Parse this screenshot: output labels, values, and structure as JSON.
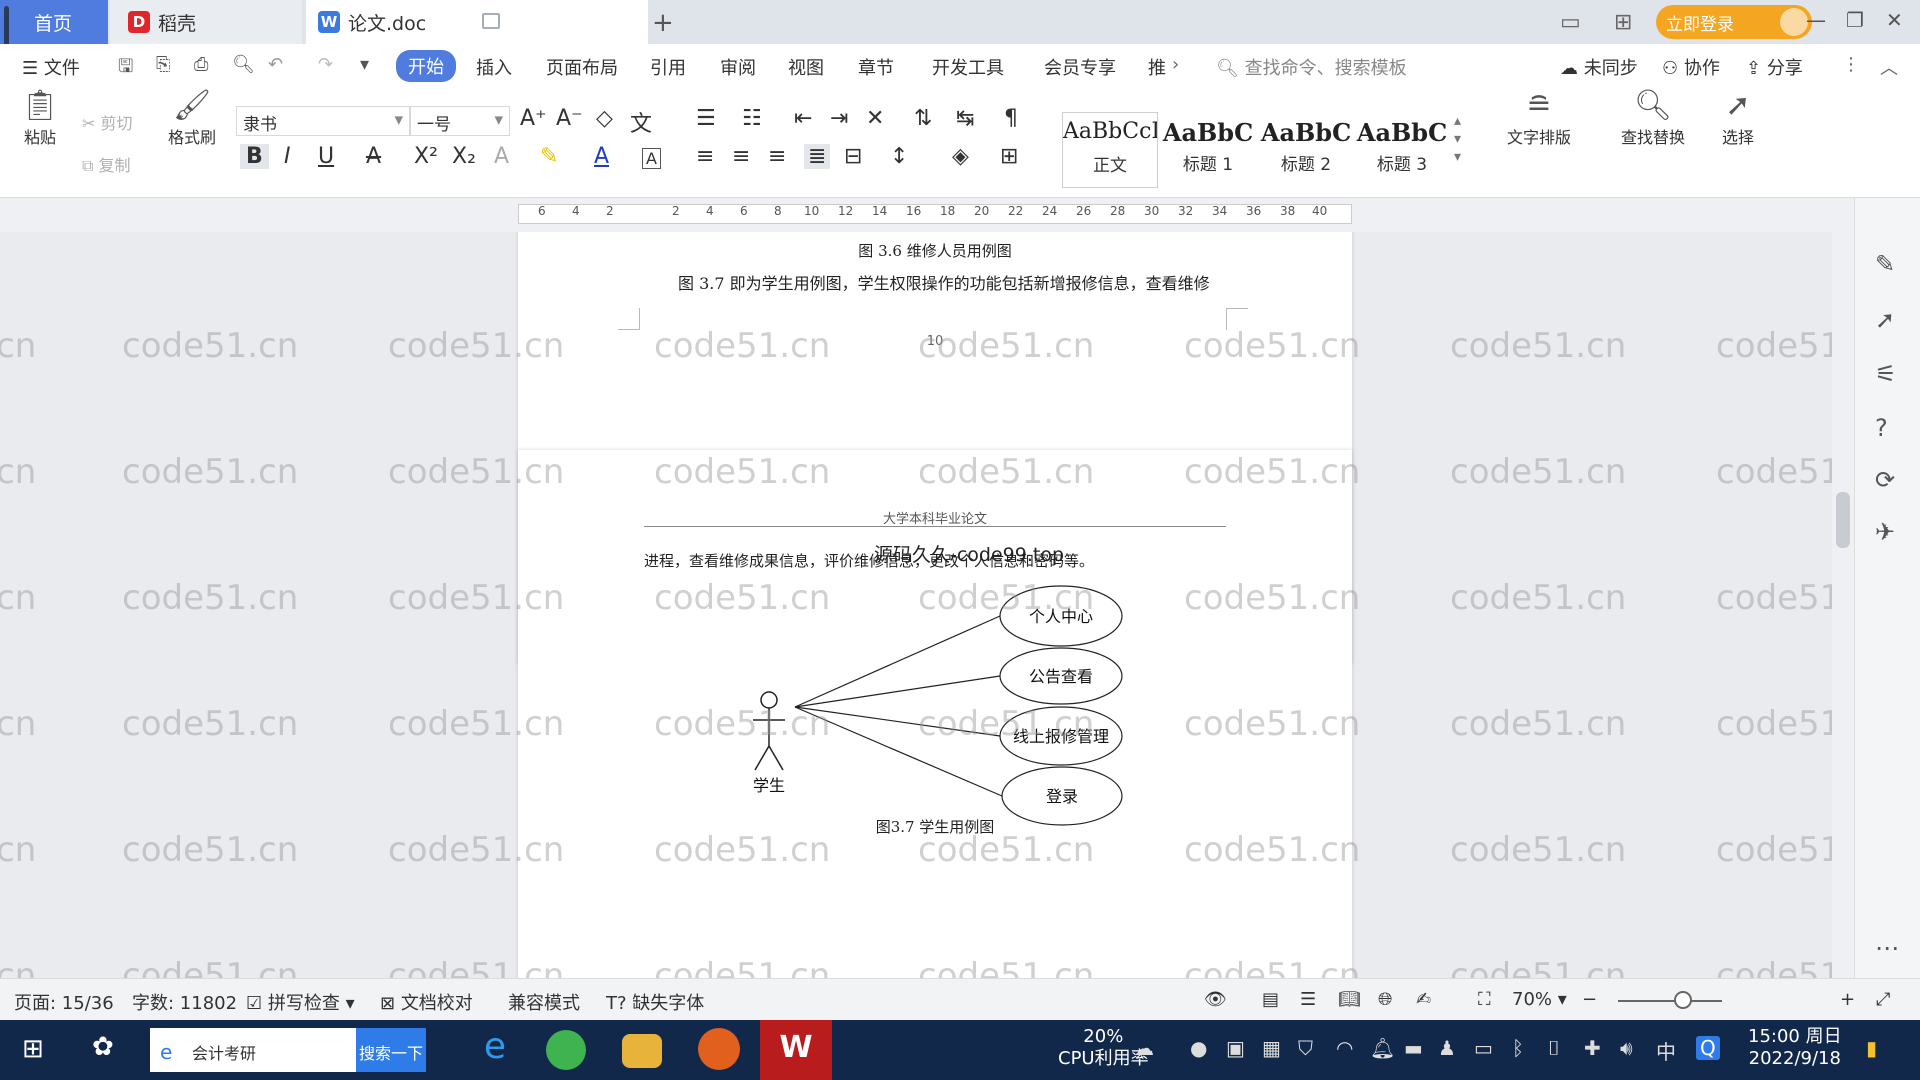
{
  "tabs": [
    {
      "label": "首页"
    },
    {
      "label": "稻壳"
    },
    {
      "label": "论文.doc"
    }
  ],
  "login_label": "立即登录",
  "menu": {
    "file": "文件",
    "items": [
      "开始",
      "插入",
      "页面布局",
      "引用",
      "审阅",
      "视图",
      "章节",
      "开发工具",
      "会员专享",
      "推"
    ],
    "search_cmd": "查找命令、搜索模板",
    "unsynced": "未同步",
    "collab": "协作",
    "share": "分享"
  },
  "toolbar": {
    "paste": "粘贴",
    "cut": "剪切",
    "copy": "复制",
    "format_painter": "格式刷",
    "font_name": "隶书",
    "font_size": "一号",
    "styles": [
      {
        "sample": "AaBbCcI",
        "name": "正文"
      },
      {
        "sample": "AaBbC",
        "name": "标题 1"
      },
      {
        "sample": "AaBbC",
        "name": "标题 2"
      },
      {
        "sample": "AaBbC",
        "name": "标题 3"
      }
    ],
    "text_layout": "文字排版",
    "find_replace": "查找替换",
    "select": "选择"
  },
  "ruler_ticks": [
    "6",
    "4",
    "2",
    "2",
    "4",
    "6",
    "8",
    "10",
    "12",
    "14",
    "16",
    "18",
    "20",
    "22",
    "24",
    "26",
    "28",
    "30",
    "32",
    "34",
    "36",
    "38",
    "40"
  ],
  "watermark": "code51.cn",
  "document": {
    "page1": {
      "figure_caption": "图 3.6  维修人员用例图",
      "paragraph": "图 3.7 即为学生用例图，学生权限操作的功能包括新增报修信息，查看维修",
      "page_number": "10"
    },
    "page2": {
      "header": "大学本科毕业论文",
      "overlay_text": "源码久久-code99.top",
      "paragraph": "进程，查看维修成果信息，评价维修信息，更改个人信息和密码等。",
      "diagram": {
        "actor": "学生",
        "use_cases": [
          "个人中心",
          "公告查看",
          "线上报修管理",
          "登录"
        ]
      },
      "figure_caption": "图3.7 学生用例图"
    }
  },
  "status": {
    "page": "页面: 15/36",
    "words": "字数: 11802",
    "spell": "拼写检查",
    "proof": "文档校对",
    "compat": "兼容模式",
    "missing_font": "缺失字体",
    "zoom": "70%"
  },
  "taskbar": {
    "search_text": "会计考研",
    "search_btn": "搜索一下",
    "cpu_percent": "20%",
    "cpu_label": "CPU利用率",
    "time": "15:00 周日",
    "date": "2022/9/18",
    "ime": "中"
  }
}
